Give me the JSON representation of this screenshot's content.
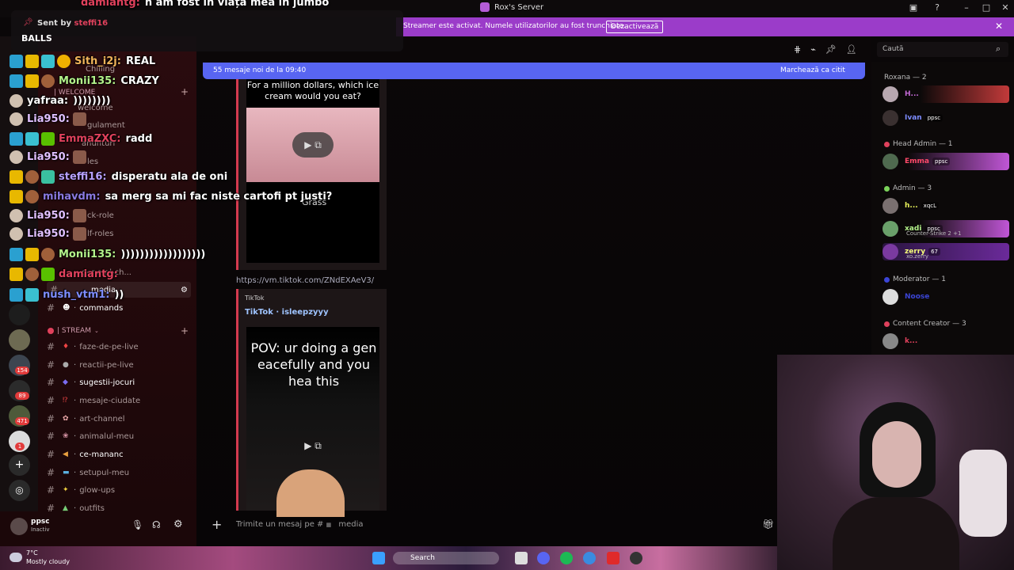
{
  "window": {
    "title": "Rox's Server",
    "search_placeholder": "Caută"
  },
  "banner": {
    "text": "Streamer este activat. Numele utilizatorilor au fost trunchiate.",
    "button": "Dezactivează",
    "color": "#9b3cc9"
  },
  "pinned": {
    "sent_by_label": "Sent by",
    "sender": "steffi16",
    "message": "BALLS"
  },
  "overlay_chat": [
    {
      "user": "damiantg:",
      "msg": "n am fost in viața mea in jumbo",
      "color": "#e0415c"
    },
    {
      "user": "Sith_i2j:",
      "msg": "REAL",
      "color": "#f0b45a"
    },
    {
      "user": "Monii135:",
      "msg": "CRAZY",
      "color": "#b3f28a"
    },
    {
      "user": "yafraa:",
      "msg": "))))))))",
      "color": "#ffffff"
    },
    {
      "user": "Lia950:",
      "msg": "",
      "color": "#e0c0ff"
    },
    {
      "user": "EmmaZXC:",
      "msg": "radd",
      "color": "#e0415c"
    },
    {
      "user": "Lia950:",
      "msg": "",
      "color": "#e0c0ff"
    },
    {
      "user": "steffi16:",
      "msg": "disperatu ala de oni",
      "color": "#b7a0ff"
    },
    {
      "user": "mihavdm:",
      "msg": "sa merg sa mi fac niste cartofi pt justi?",
      "color": "#8a79e0"
    },
    {
      "user": "Lia950:",
      "msg": "",
      "color": "#e0c0ff"
    },
    {
      "user": "Lia950:",
      "msg": "",
      "color": "#e0c0ff"
    },
    {
      "user": "Monii135:",
      "msg": "))))))))))))))))))",
      "color": "#b3f28a"
    },
    {
      "user": "damiantg:",
      "msg": "",
      "color": "#e0415c"
    },
    {
      "user": "nush_vtm1:",
      "msg": "))",
      "color": "#7d8cff"
    }
  ],
  "sidebar": {
    "top_channels": [
      "Chilling",
      "welcome",
      "gulament",
      "anunturi",
      "les",
      "ck-role",
      "lf-roles",
      "general-ch...",
      "media",
      "commands"
    ],
    "welcome_category": "| WELCOME",
    "stream_category": "| STREAM",
    "stream_channels": [
      {
        "name": "faze-de-pe-live",
        "bold": false
      },
      {
        "name": "reactii-pe-live",
        "bold": false
      },
      {
        "name": "sugestii-jocuri",
        "bold": true
      },
      {
        "name": "mesaje-ciudate",
        "bold": false
      },
      {
        "name": "art-channel",
        "bold": false
      },
      {
        "name": "animalul-meu",
        "bold": false
      },
      {
        "name": "ce-mananc",
        "bold": true
      },
      {
        "name": "setupul-meu",
        "bold": false
      },
      {
        "name": "glow-ups",
        "bold": false
      },
      {
        "name": "outfits",
        "bold": false
      }
    ]
  },
  "user_panel": {
    "name": "ppsc",
    "status": "Inactiv"
  },
  "server_rail": {
    "badges": [
      "154",
      "89",
      "471",
      "1"
    ]
  },
  "chat": {
    "new_messages": "55 mesaje noi de la 09:40",
    "mark_read": "Marchează ca citit",
    "embed1_question": "For a million dollars, which ice cream would you eat?",
    "embed1_caption": "Grass",
    "link": "https://vm.tiktok.com/ZNdEXAeV3/",
    "embed2_provider": "TikTok",
    "embed2_title": "TikTok · isleepzyyy",
    "embed2_video_text": "POV: ur doing a gen eacefully and you hea this",
    "composer_placeholder": "Trimite un mesaj pe #",
    "composer_channel": "media"
  },
  "members": {
    "groups": [
      {
        "title": "Roxana — 2",
        "color": "#e0415c"
      },
      {
        "title": "Head Admin — 1",
        "color": "#e0415c"
      },
      {
        "title": "Admin — 3",
        "color": "#7bd35a"
      },
      {
        "title": "Moderator — 1",
        "color": "#3b45d6"
      },
      {
        "title": "Content Creator — 3",
        "color": "#e0415c"
      }
    ],
    "list": [
      {
        "name": "H...",
        "color": "#c46ad6",
        "tag": "",
        "sub": ""
      },
      {
        "name": "Ivan",
        "color": "#7d8cff",
        "tag": "ppsc",
        "sub": ""
      },
      {
        "name": "Emma",
        "color": "#ff4a6a",
        "tag": "ppsc",
        "sub": ""
      },
      {
        "name": "h...",
        "color": "#e8f25a",
        "tag": "xqcL",
        "sub": ""
      },
      {
        "name": "xadi",
        "color": "#b3f28a",
        "tag": "ppsc",
        "sub": "Counter-Strike 2 +1"
      },
      {
        "name": "zerry",
        "color": "#f7ff7a",
        "tag": "67",
        "sub": "xo.zerry"
      },
      {
        "name": "Noose",
        "color": "#3b45d6",
        "tag": "",
        "sub": ""
      },
      {
        "name": "k...",
        "color": "#e0415c",
        "tag": "",
        "sub": ""
      }
    ]
  },
  "taskbar": {
    "temp": "7°C",
    "weather": "Mostly cloudy",
    "search": "Search"
  }
}
